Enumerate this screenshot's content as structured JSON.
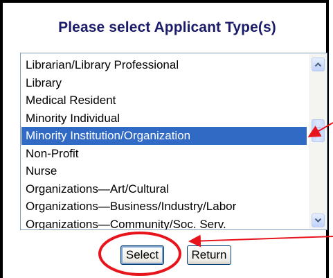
{
  "title": "Please select Applicant Type(s)",
  "applicant_list": {
    "items": [
      "Librarian/Library Professional",
      "Library",
      "Medical Resident",
      "Minority Individual",
      "Minority Institution/Organization",
      "Non-Profit",
      "Nurse",
      "Organizations—Art/Cultural",
      "Organizations—Business/Industry/Labor",
      "Organizations—Community/Soc. Serv."
    ],
    "selected_index": 4
  },
  "buttons": {
    "select_label": "Select",
    "return_label": "Return"
  },
  "colors": {
    "title": "#1b1b6b",
    "selection": "#316ac5",
    "annotation": "#e8141c"
  },
  "icons": {
    "scroll_up": "chevron-up-icon",
    "scroll_down": "chevron-down-icon"
  }
}
